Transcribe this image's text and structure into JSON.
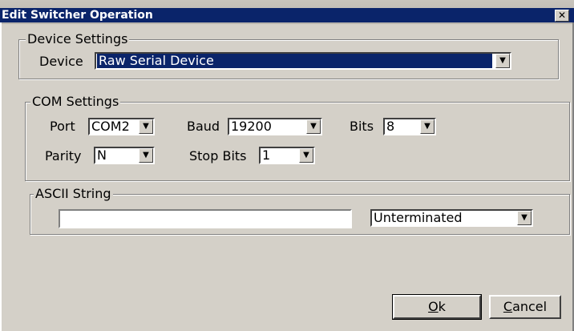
{
  "window": {
    "title": "Edit Switcher Operation",
    "close_glyph": "✕"
  },
  "device_settings": {
    "legend": "Device Settings",
    "device_label": "Device",
    "device_value": "Raw Serial Device"
  },
  "com_settings": {
    "legend": "COM Settings",
    "port_label": "Port",
    "port_value": "COM2",
    "baud_label": "Baud",
    "baud_value": "19200",
    "bits_label": "Bits",
    "bits_value": "8",
    "parity_label": "Parity",
    "parity_value": "N",
    "stop_bits_label": "Stop Bits",
    "stop_bits_value": "1"
  },
  "ascii_string": {
    "legend": "ASCII String",
    "input_value": "",
    "terminator_value": "Unterminated"
  },
  "buttons": {
    "ok_label": "Ok",
    "cancel_label": "Cancel"
  },
  "icons": {
    "dropdown": "chevron-down-icon",
    "close": "close-icon"
  }
}
